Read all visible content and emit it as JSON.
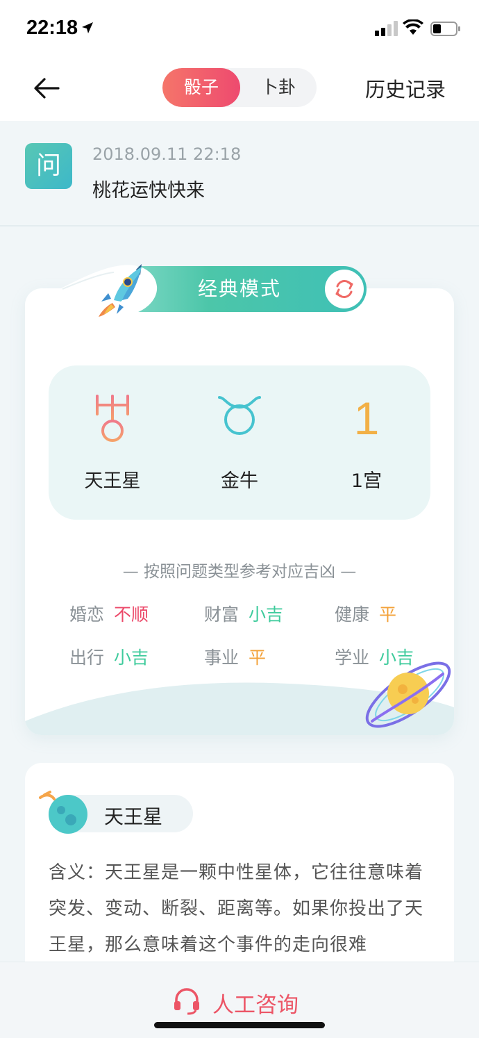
{
  "status": {
    "time": "22:18"
  },
  "header": {
    "tabs": [
      {
        "label": "骰子",
        "active": true
      },
      {
        "label": "卜卦",
        "active": false
      }
    ],
    "history_label": "历史记录"
  },
  "question": {
    "badge": "问",
    "datetime": "2018.09.11 22:18",
    "text": "桃花运快快来"
  },
  "result": {
    "mode_label": "经典模式",
    "dice": [
      {
        "label": "天王星",
        "icon": "uranus-symbol-icon"
      },
      {
        "label": "金牛",
        "icon": "taurus-symbol-icon"
      },
      {
        "label": "1宫",
        "number": "1"
      }
    ],
    "reference_title": "— 按照问题类型参考对应吉凶 —",
    "fortunes": [
      {
        "category": "婚恋",
        "value": "不顺",
        "color": "#ec4a6a"
      },
      {
        "category": "财富",
        "value": "小吉",
        "color": "#3ecb9c"
      },
      {
        "category": "健康",
        "value": "平",
        "color": "#f3a23a"
      },
      {
        "category": "出行",
        "value": "小吉",
        "color": "#3ecb9c"
      },
      {
        "category": "事业",
        "value": "平",
        "color": "#f3a23a"
      },
      {
        "category": "学业",
        "value": "小吉",
        "color": "#3ecb9c"
      }
    ]
  },
  "detail": {
    "title": "天王星",
    "text": "含义：天王星是一颗中性星体，它往往意味着突发、变动、断裂、距离等。如果你投出了天王星，那么意味着这个事件的走向很难"
  },
  "bottom": {
    "consult_label": "人工咨询"
  },
  "colors": {
    "accent_red": "#ee4a6f",
    "accent_green": "#4cc6a9",
    "accent_orange": "#f2b046"
  }
}
